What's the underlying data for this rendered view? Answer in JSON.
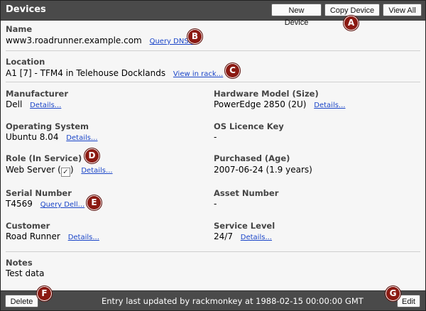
{
  "header": {
    "title": "Devices",
    "buttons": {
      "new": "New Device",
      "copy": "Copy Device",
      "view_all": "View All"
    }
  },
  "device": {
    "name": {
      "label": "Name",
      "value": "www3.roadrunner.example.com",
      "link": "Query DNS..."
    },
    "location": {
      "label": "Location",
      "value": "A1 [7] - TFM4 in Telehouse Docklands",
      "link": "View in rack..."
    },
    "manufacturer": {
      "label": "Manufacturer",
      "value": "Dell",
      "link": "Details..."
    },
    "hardware_model": {
      "label": "Hardware Model (Size)",
      "value": "PowerEdge 2850 (2U)",
      "link": "Details..."
    },
    "os": {
      "label": "Operating System",
      "value": "Ubuntu 8.04",
      "link": "Details..."
    },
    "os_licence": {
      "label": "OS Licence Key",
      "value": "-"
    },
    "role": {
      "label": "Role (In Service)",
      "value": "Web Server (",
      "value_end": ")",
      "in_service_mark": "✓",
      "link": "Details..."
    },
    "purchased": {
      "label": "Purchased (Age)",
      "value": "2007-06-24  (1.9 years)"
    },
    "serial": {
      "label": "Serial Number",
      "value": "T4569",
      "link": "Query Dell..."
    },
    "asset": {
      "label": "Asset Number",
      "value": "-"
    },
    "customer": {
      "label": "Customer",
      "value": "Road Runner",
      "link": "Details..."
    },
    "service_level": {
      "label": "Service Level",
      "value": "24/7",
      "link": "Details..."
    },
    "notes": {
      "label": "Notes",
      "value": "Test data"
    }
  },
  "footer": {
    "delete": "Delete",
    "edit": "Edit",
    "updated_text": "Entry last updated by rackmonkey at 1988-02-15 00:00:00 GMT"
  },
  "badges": {
    "a": "A",
    "b": "B",
    "c": "C",
    "d": "D",
    "e": "E",
    "f": "F",
    "g": "G"
  },
  "colors": {
    "header_bg": "#4a4a4a",
    "badge": "#8b1a12",
    "link": "#1a45c8"
  }
}
